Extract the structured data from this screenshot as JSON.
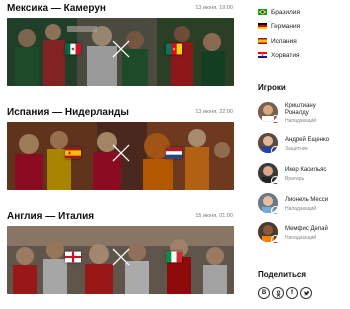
{
  "matches": [
    {
      "title": "Мексика — Камерун",
      "date": "13 июня, 19:00",
      "left_flag": "mexico-flag-icon",
      "right_flag": "cameroon-flag-icon"
    },
    {
      "title": "Испания — Нидерланды",
      "date": "13 июня, 22:00",
      "left_flag": "spain-flag-icon",
      "right_flag": "netherlands-flag-icon"
    },
    {
      "title": "Англия — Италия",
      "date": "15 июня, 01:00",
      "left_flag": "england-flag-icon",
      "right_flag": "italy-flag-icon"
    }
  ],
  "teams": [
    {
      "name": "Бразилия",
      "flag": "brazil-flag-icon"
    },
    {
      "name": "Германия",
      "flag": "germany-flag-icon"
    },
    {
      "name": "Испания",
      "flag": "spain-flag-icon"
    },
    {
      "name": "Хорватия",
      "flag": "croatia-flag-icon"
    }
  ],
  "players_title": "Игроки",
  "players": [
    {
      "name_line1": "Криштиану",
      "name_line2": "Роналду",
      "position": "Нападающий",
      "flag": "portugal-flag-icon"
    },
    {
      "name_line1": "Андрей Ещенко",
      "name_line2": "",
      "position": "Защитник",
      "flag": "russia-flag-icon"
    },
    {
      "name_line1": "Икер Касильяс",
      "name_line2": "",
      "position": "Вратарь",
      "flag": "spain-flag-icon"
    },
    {
      "name_line1": "Лионель Месси",
      "name_line2": "",
      "position": "Нападающий",
      "flag": "argentina-flag-icon"
    },
    {
      "name_line1": "Мемфис Депай",
      "name_line2": "",
      "position": "Нападающий",
      "flag": "netherlands-flag-icon"
    }
  ],
  "share_title": "Поделиться",
  "share_buttons": [
    {
      "label": "В",
      "icon": "vk-icon"
    },
    {
      "label": "ok",
      "icon": "odnoklassniki-icon"
    },
    {
      "label": "f",
      "icon": "facebook-icon"
    },
    {
      "label": "t",
      "icon": "twitter-icon"
    }
  ],
  "colors": {
    "accent_bg": "#ffffff",
    "text": "#111111",
    "muted": "#888888"
  }
}
